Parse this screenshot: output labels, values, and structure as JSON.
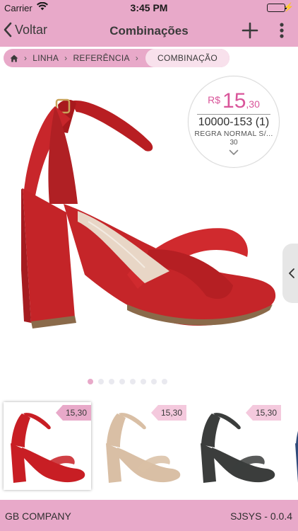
{
  "status_bar": {
    "carrier": "Carrier",
    "time": "3:45 PM"
  },
  "nav": {
    "back_label": "Voltar",
    "title": "Combinações"
  },
  "breadcrumb": {
    "items": [
      "LINHA",
      "REFERÊNCIA",
      "COMBINAÇÃO"
    ]
  },
  "product": {
    "price": {
      "currency": "R$",
      "integer": "15",
      "decimal": ",30"
    },
    "reference": "10000-153 (1)",
    "rule": "REGRA NORMAL S/...",
    "size": "30",
    "pager": {
      "count": 8,
      "active": 0
    }
  },
  "thumbnails": [
    {
      "price": "15,30",
      "color": "#c81e24"
    },
    {
      "price": "15,30",
      "color": "#d9bfa5"
    },
    {
      "price": "15,30",
      "color": "#3b3d3c"
    },
    {
      "price": "",
      "color": "#2f4a7a"
    }
  ],
  "footer": {
    "company": "GB COMPANY",
    "version": "SJSYS - 0.0.4"
  },
  "colors": {
    "accent_pink": "#e8a9c9",
    "price_pink": "#d9559a"
  }
}
